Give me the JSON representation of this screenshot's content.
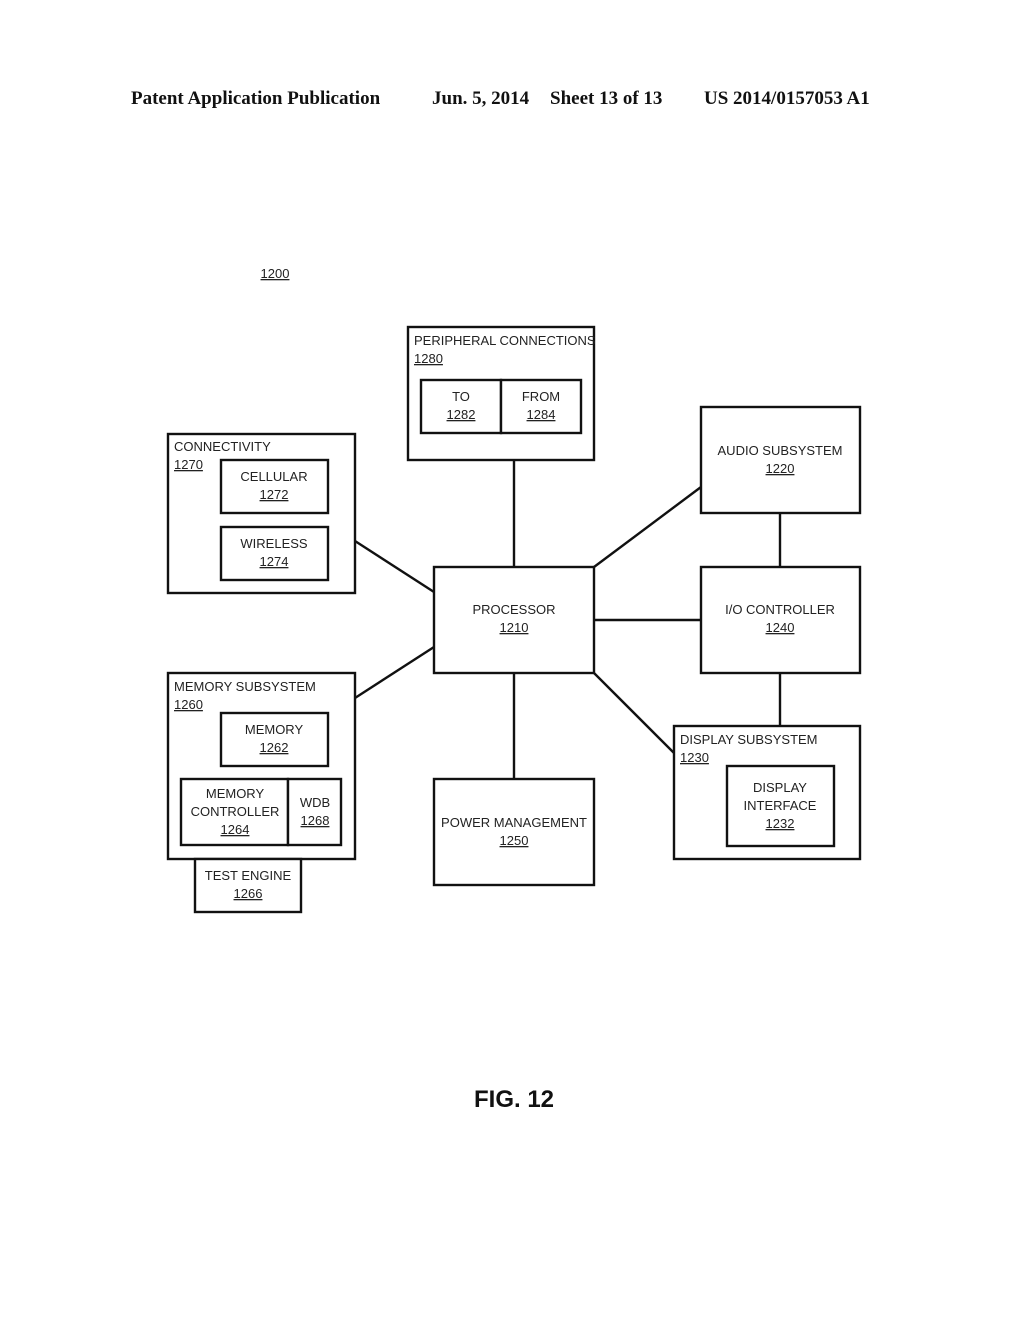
{
  "header": {
    "left": "Patent Application Publication",
    "date": "Jun. 5, 2014",
    "sheet": "Sheet 13 of 13",
    "pub_number": "US 2014/0157053 A1"
  },
  "figure": {
    "reference": "1200",
    "caption": "FIG. 12"
  },
  "blocks": {
    "peripheral": {
      "label": "PERIPHERAL CONNECTIONS",
      "number": "1280"
    },
    "to": {
      "label": "TO",
      "number": "1282"
    },
    "from": {
      "label": "FROM",
      "number": "1284"
    },
    "connectivity": {
      "label": "CONNECTIVITY",
      "number": "1270"
    },
    "cellular": {
      "label": "CELLULAR",
      "number": "1272"
    },
    "wireless": {
      "label": "WIRELESS",
      "number": "1274"
    },
    "audio": {
      "label": "AUDIO SUBSYSTEM",
      "number": "1220"
    },
    "processor": {
      "label": "PROCESSOR",
      "number": "1210"
    },
    "io": {
      "label": "I/O CONTROLLER",
      "number": "1240"
    },
    "memory_subsystem": {
      "label": "MEMORY SUBSYSTEM",
      "number": "1260"
    },
    "memory": {
      "label": "MEMORY",
      "number": "1262"
    },
    "memory_controller": {
      "label_line1": "MEMORY",
      "label_line2": "CONTROLLER",
      "number": "1264"
    },
    "wdb": {
      "label": "WDB",
      "number": "1268"
    },
    "test_engine": {
      "label": "TEST ENGINE",
      "number": "1266"
    },
    "power": {
      "label": "POWER MANAGEMENT",
      "number": "1250"
    },
    "display_subsystem": {
      "label": "DISPLAY SUBSYSTEM",
      "number": "1230"
    },
    "display_interface": {
      "label_line1": "DISPLAY",
      "label_line2": "INTERFACE",
      "number": "1232"
    }
  }
}
